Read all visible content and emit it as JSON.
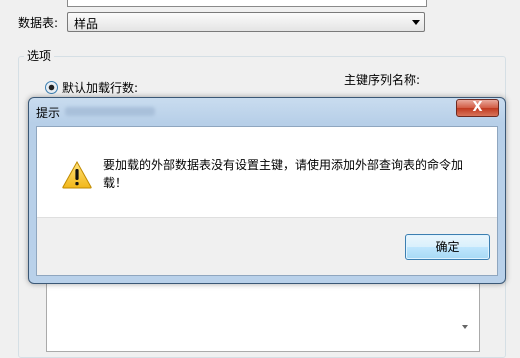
{
  "background_dialog": {
    "table_label": "数据表:",
    "table_value": "样品",
    "options_group_title": "选项",
    "default_load_rows_label": "默认加载行数:",
    "primary_key_column_label": "主键序列名称:"
  },
  "message_box": {
    "title": "提示",
    "close_label": "X",
    "message": "要加载的外部数据表没有设置主键，请使用添加外部查询表的命令加载！",
    "icon": "warning-icon",
    "ok_label": "确定"
  },
  "colors": {
    "window_frame": "#b9d1ea",
    "close_button": "#c0391f",
    "focus_button_border": "#3c7fb1",
    "warning_icon": "#f4c430"
  }
}
